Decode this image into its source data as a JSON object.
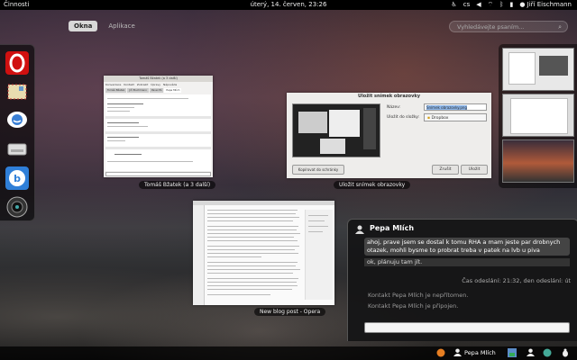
{
  "topbar": {
    "activities": "Činnosti",
    "clock": "úterý, 14. červen, 23:26",
    "keyboard_layout": "cs",
    "user_name": "Jiří Eischmann",
    "icons": [
      "accessibility-icon",
      "keyboard-icon",
      "volume-icon",
      "network-icon",
      "bluetooth-icon",
      "battery-icon",
      "user-icon"
    ]
  },
  "view_tabs": {
    "windows": "Okna",
    "applications": "Aplikace"
  },
  "search": {
    "placeholder": "Vyhledávejte psaním..."
  },
  "dash": {
    "apps": [
      "opera-icon",
      "mail-icon",
      "chat-icon",
      "disk-icon",
      "bittorrent-icon",
      "camera-icon"
    ]
  },
  "windows": {
    "chat_window": {
      "caption": "Tomáš Bžatek (a 3 další)",
      "title": "Tomáš Bžatek (a 3 další)",
      "menu": [
        "Konverzace",
        "Kontakt",
        "Zobrazit",
        "Úpravy",
        "Nápověda"
      ],
      "tabs": [
        "Tomáš Bžatek",
        "Jiří Eischmann",
        "Pavel Pš",
        "Pepa Mlích"
      ]
    },
    "screenshot_dialog": {
      "caption": "Uložit snímek obrazovky",
      "title": "Uložit snímek obrazovky",
      "name_label": "Název:",
      "name_value": "Snímek obrazovky.png",
      "folder_label": "Uložit do složky:",
      "folder_value": "Dropbox",
      "copy_button": "Kopírovat do schránky",
      "cancel_button": "Zrušit",
      "save_button": "Uložit"
    },
    "blog_window": {
      "caption": "New blog post - Opera"
    }
  },
  "chat": {
    "contact": "Pepa Mlích",
    "message1": "ahoj, prave jsem se dostal k tomu RHA a mam jeste par drobnych otazek, mohli bysme to probrat treba v patek na lvb u piva",
    "message2": "ok, plánuju tam jít.",
    "sent_time": "Čas odeslání: 21:32, den odeslání: út",
    "status_offline": "Kontakt Pepa Mlích je nepřítomen.",
    "status_connected": "Kontakt Pepa Mlích je připojen."
  },
  "message_tray": {
    "contact_label": "Pepa Mlích"
  }
}
